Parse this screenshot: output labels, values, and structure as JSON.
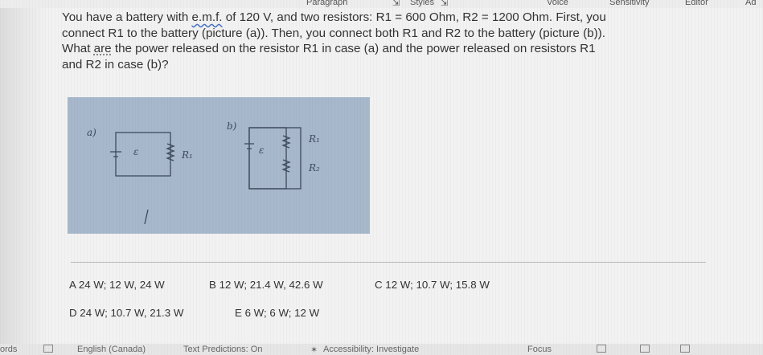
{
  "ribbon": {
    "paragraph_label": "Paragraph",
    "styles_label": "Styles",
    "voice_label": "Voice",
    "sensitivity_label": "Sensitivity",
    "editor_label": "Editor",
    "addins_label": "Ad"
  },
  "question": {
    "line1_pre": "You have a battery with ",
    "emf": "e.m.f.",
    "line1_post": " of 120 V, and two resistors: R1 = 600 Ohm, R2 = 1200 Ohm. First, you",
    "line2": "connect R1 to the battery (picture (a)). Then, you connect both R1 and R2 to the battery (picture (b)).",
    "line3_pre": "What ",
    "are": "are",
    "line3_post": " the power released on the resistor R1 in case (a) and the power released on resistors R1",
    "line4": "and R2 in case (b)?"
  },
  "sketch": {
    "label_a": "a)",
    "label_b": "b)",
    "emf_a": "ε",
    "emf_b": "ε",
    "r1_a": "R₁",
    "r1_b": "R₁",
    "r2_b": "R₂"
  },
  "options": {
    "a": "A 24 W; 12 W, 24 W",
    "b": "B 12 W; 21.4 W, 42.6 W",
    "c": "C 12 W; 10.7 W; 15.8 W",
    "d": "D 24 W; 10.7 W, 21.3 W",
    "e": "E 6 W; 6 W; 12 W"
  },
  "status": {
    "words": "ords",
    "language": "English (Canada)",
    "predictions": "Text Predictions: On",
    "accessibility": "Accessibility: Investigate",
    "focus": "Focus"
  },
  "colors": {
    "sketch_bg": "#a8b8cc",
    "page_bg": "#f2f2f2",
    "spell_underline": "#4a72c4"
  }
}
